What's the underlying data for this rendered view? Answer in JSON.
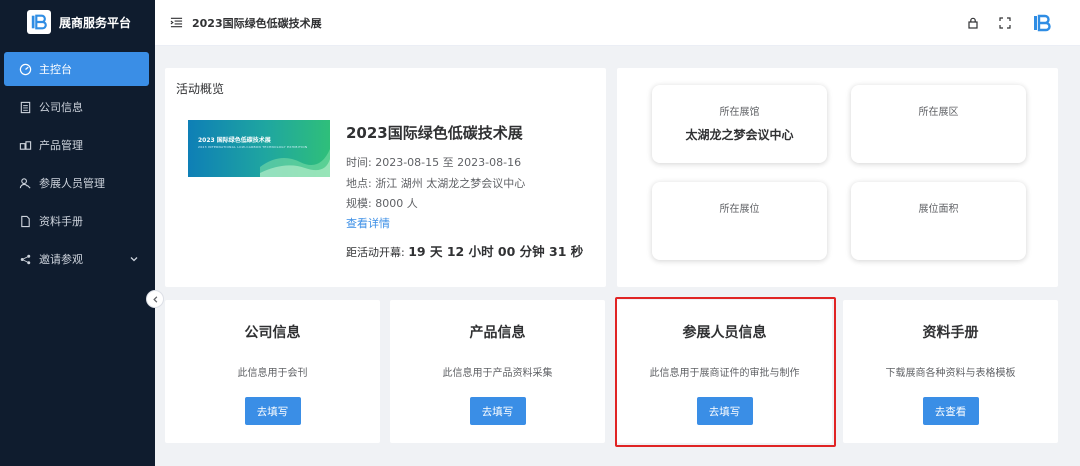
{
  "brand": {
    "title": "展商服务平台"
  },
  "sidebar": {
    "items": [
      {
        "label": "主控台",
        "icon": "dashboard-icon",
        "active": true
      },
      {
        "label": "公司信息",
        "icon": "document-list-icon",
        "active": false
      },
      {
        "label": "产品管理",
        "icon": "product-icon",
        "active": false
      },
      {
        "label": "参展人员管理",
        "icon": "people-icon",
        "active": false
      },
      {
        "label": "资料手册",
        "icon": "file-icon",
        "active": false
      },
      {
        "label": "邀请参观",
        "icon": "share-icon",
        "active": false,
        "expandable": true
      }
    ]
  },
  "header": {
    "title": "2023国际绿色低碳技术展",
    "icons": [
      "lock-icon",
      "fullscreen-icon",
      "logo-icon"
    ]
  },
  "overview": {
    "section_title": "活动概览",
    "banner_text": "2023 国际绿色低碳技术展",
    "banner_sub": "2023 INTERNATIONAL LOW-CARBON TECHNOLOGY EXHIBITION",
    "event_name": "2023国际绿色低碳技术展",
    "time_label": "时间:",
    "time_value": "2023-08-15 至 2023-08-16",
    "location_label": "地点:",
    "location_value": "浙江 湖州 太湖龙之梦会议中心",
    "scale_label": "规模:",
    "scale_value": "8000 人",
    "detail_link": "查看详情",
    "countdown_label": "距活动开幕:",
    "countdown_value": "19 天 12 小时 00 分钟 31 秒"
  },
  "stats": [
    {
      "label": "所在展馆",
      "value": "太湖龙之梦会议中心"
    },
    {
      "label": "所在展区",
      "value": ""
    },
    {
      "label": "所在展位",
      "value": ""
    },
    {
      "label": "展位面积",
      "value": ""
    }
  ],
  "cards": [
    {
      "title": "公司信息",
      "desc": "此信息用于会刊",
      "button": "去填写"
    },
    {
      "title": "产品信息",
      "desc": "此信息用于产品资料采集",
      "button": "去填写"
    },
    {
      "title": "参展人员信息",
      "desc": "此信息用于展商证件的审批与制作",
      "button": "去填写"
    },
    {
      "title": "资料手册",
      "desc": "下载展商各种资料与表格模板",
      "button": "去查看"
    }
  ],
  "colors": {
    "sidebar_bg": "#0f1c2e",
    "accent": "#3a8ee6",
    "highlight": "#e02424"
  }
}
